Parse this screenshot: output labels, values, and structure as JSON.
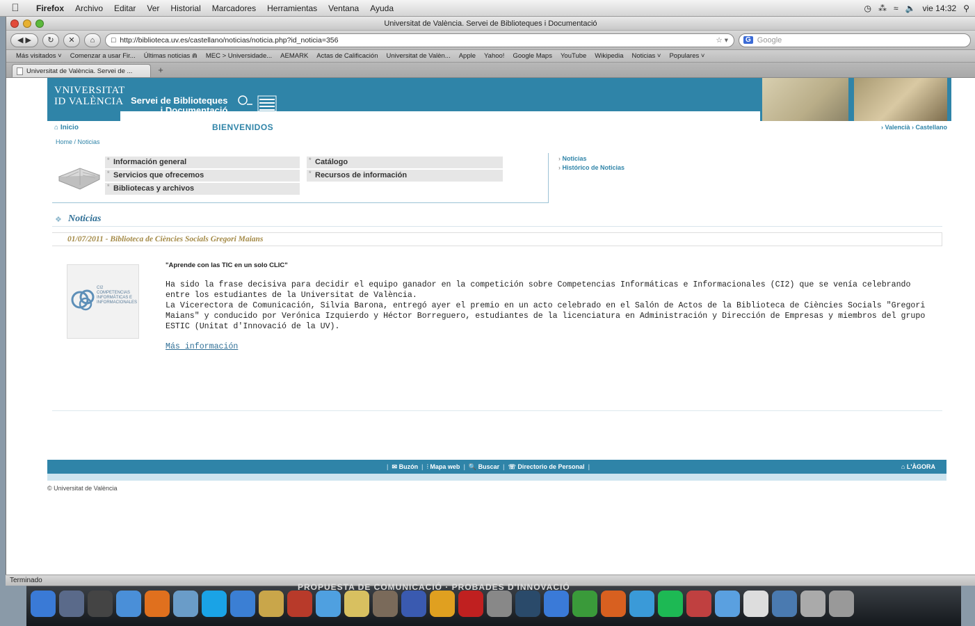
{
  "menubar": {
    "app": "Firefox",
    "items": [
      "Archivo",
      "Editar",
      "Ver",
      "Historial",
      "Marcadores",
      "Herramientas",
      "Ventana",
      "Ayuda"
    ],
    "clock": "vie 14:32"
  },
  "window": {
    "title": "Universitat de València. Servei de Biblioteques i Documentació"
  },
  "navbar": {
    "url": "http://biblioteca.uv.es/castellano/noticias/noticia.php?id_noticia=356",
    "search_placeholder": "Google"
  },
  "bookmarks": [
    "Más visitados ˅",
    "Comenzar a usar Fir...",
    "Últimas noticias ⋒",
    "MEC > Universidade...",
    "AEMARK",
    "Actas de Calificación",
    "Universitat de Valèn...",
    "Apple",
    "Yahoo!",
    "Google Maps",
    "YouTube",
    "Wikipedia",
    "Noticias ˅",
    "Populares ˅"
  ],
  "tab": {
    "label": "Universitat de València. Servei de ...",
    "new_tab": "+"
  },
  "site": {
    "logo_line1": "VNIVERSITAT",
    "logo_line2": "ID VALÈNCIA",
    "service_line1": "Servei de Biblioteques",
    "service_line2": "i Documentació",
    "inicio": "⌂ Inicio",
    "welcome": "BIENVENIDOS",
    "langs": "› Valencià › Castellano",
    "breadcrumb": "Home / Noticias",
    "menu": [
      "Información general",
      "Servicios que ofrecemos",
      "Bibliotecas y archivos",
      "Catálogo",
      "Recursos de información"
    ],
    "side_links": [
      "Noticias",
      "Histórico de Noticias"
    ]
  },
  "news": {
    "section": "Noticias",
    "date_title": "01/07/2011 - Biblioteca de Ciències Socials Gregori Maians",
    "image_caption": "CI2 COMPETENCIAS INFORMÁTICAS E INFORMACIONALES",
    "lead": "\"Aprende con las TIC en un solo CLIC\"",
    "p1": "Ha sido la frase decisiva para decidir el equipo ganador en la competición sobre Competencias Informáticas e Informacionales (CI2) que se venía celebrando entre los estudiantes de la Universitat de València.",
    "p2": "La Vicerectora de Comunicación, Silvia Barona, entregó ayer el premio en un acto celebrado en el Salón de Actos de la Biblioteca de Ciències Socials \"Gregori Maians\" y conducido por Verónica Izquierdo y Héctor Borreguero, estudiantes de la licenciatura en Administración y Dirección de Empresas y miembros del grupo ESTIC (Unitat d'Innovació de la UV).",
    "more": "Más información"
  },
  "footer": {
    "links": [
      "✉ Buzón",
      "⫶ Mapa web",
      "🔍 Buscar",
      "☏ Directorio de Personal"
    ],
    "agora": "⌂ L'ÀGORA",
    "copyright": "© Universitat de València"
  },
  "status": "Terminado",
  "dock_behind_text": "PROPUESTA DE COMUNICACIÓ · PROBADES D'INNOVACIÓ"
}
